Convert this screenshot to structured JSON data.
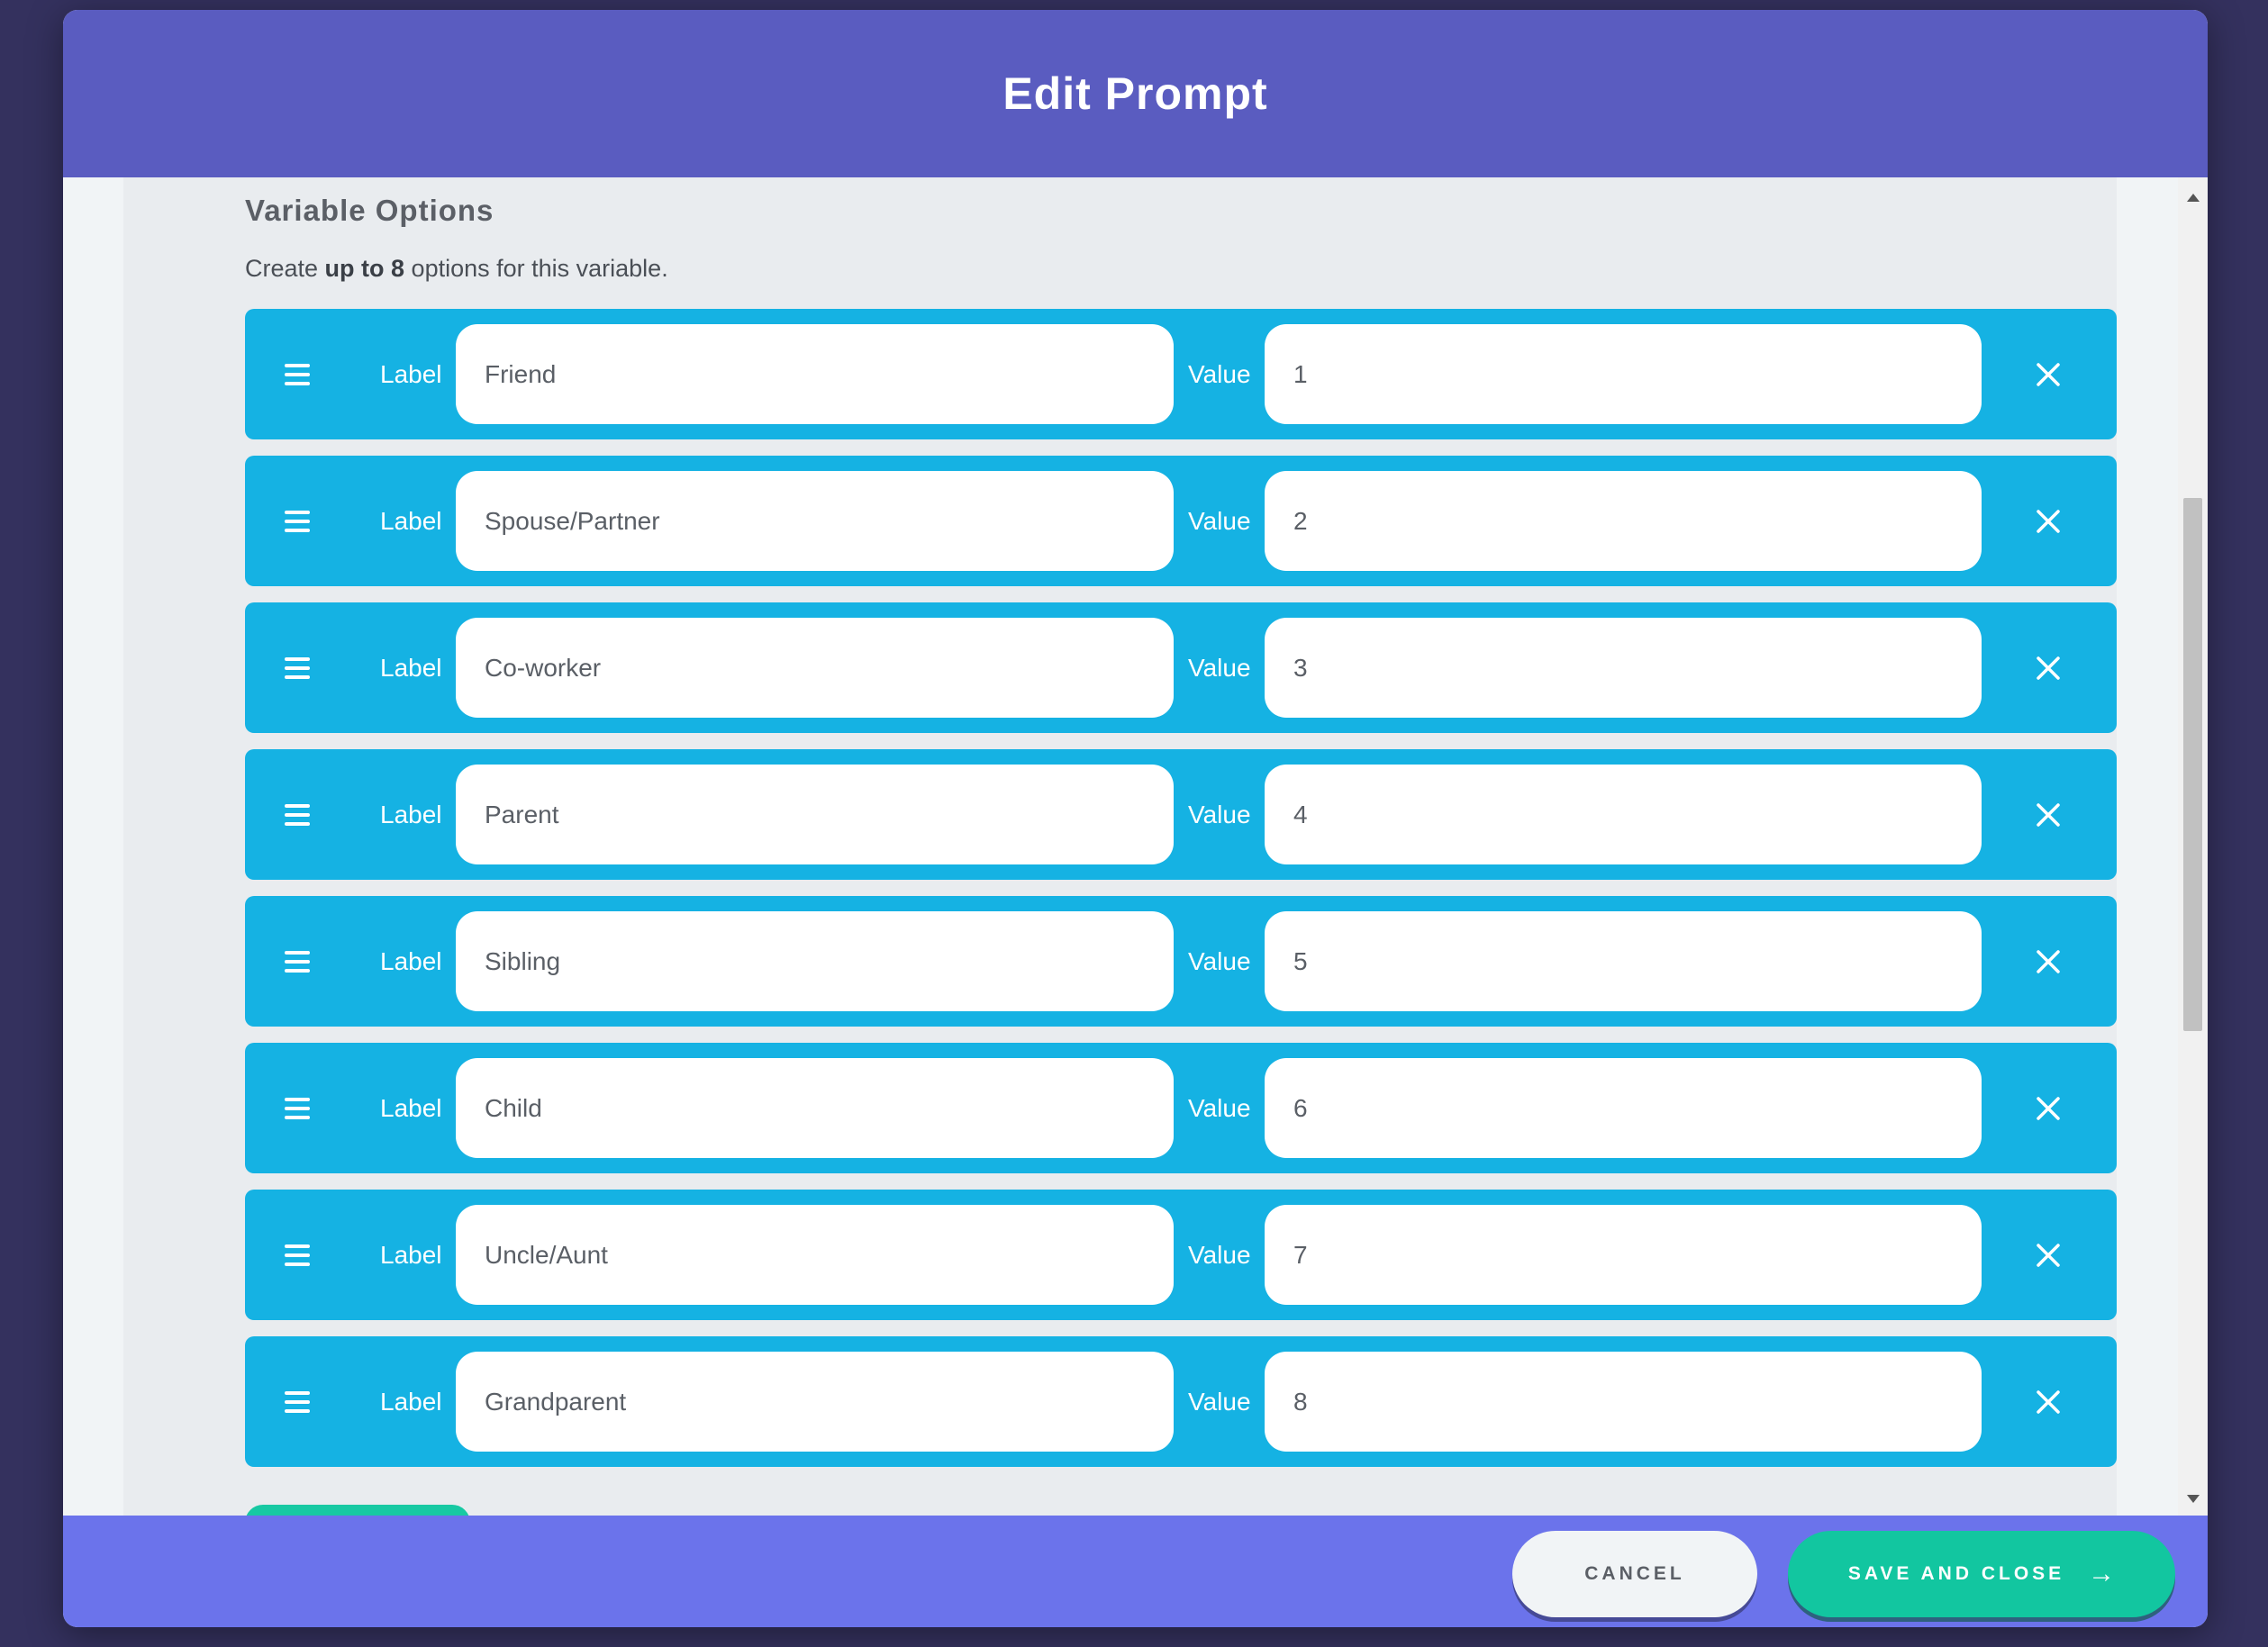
{
  "modal": {
    "title": "Edit Prompt"
  },
  "section": {
    "title": "Variable Options",
    "desc_prefix": "Create ",
    "desc_bold": "up to 8",
    "desc_suffix": " options for this variable."
  },
  "field_labels": {
    "label": "Label",
    "value": "Value"
  },
  "options": [
    {
      "label": "Friend",
      "value": "1"
    },
    {
      "label": "Spouse/Partner",
      "value": "2"
    },
    {
      "label": "Co-worker",
      "value": "3"
    },
    {
      "label": "Parent",
      "value": "4"
    },
    {
      "label": "Sibling",
      "value": "5"
    },
    {
      "label": "Child",
      "value": "6"
    },
    {
      "label": "Uncle/Aunt",
      "value": "7"
    },
    {
      "label": "Grandparent",
      "value": "8"
    }
  ],
  "footer": {
    "cancel_label": "CANCEL",
    "save_label": "SAVE AND CLOSE"
  },
  "icons": {
    "drag": "drag-handle-icon",
    "remove": "close-icon",
    "arrow": "arrow-right-icon"
  },
  "colors": {
    "header": "#5a5cc0",
    "footer": "#6b73eb",
    "row": "#15b2e3",
    "save": "#12c6a0"
  }
}
